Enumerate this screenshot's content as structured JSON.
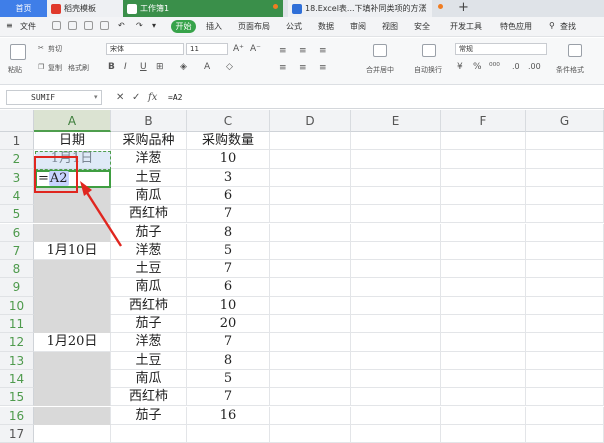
{
  "tabs": {
    "home": "首页",
    "template": "稻壳模板",
    "workbook": "工作簿1",
    "document": "18.Excel表...下填补同类项的方法"
  },
  "menu": {
    "file": "文件",
    "start": "开始",
    "items": [
      "插入",
      "页面布局",
      "公式",
      "数据",
      "审阅",
      "视图",
      "安全",
      "开发工具",
      "特色应用"
    ],
    "search": "查找"
  },
  "ribbon": {
    "cut": "剪切",
    "copy": "复制",
    "paste": "粘贴",
    "format_painter": "格式刷",
    "font": "宋体",
    "font_size": "11",
    "merge": "合并居中",
    "wrap": "自动换行",
    "number_format": "常规",
    "cond_format": "条件格式"
  },
  "formula_bar": {
    "name_box": "SUMIF",
    "cancel": "✕",
    "confirm": "✓",
    "fx": "fx",
    "formula": "=A2"
  },
  "grid": {
    "columns": [
      "A",
      "B",
      "C",
      "D",
      "E",
      "F",
      "G"
    ],
    "rows": [
      "1",
      "2",
      "3",
      "4",
      "5",
      "6",
      "7",
      "8",
      "9",
      "10",
      "11",
      "12",
      "13",
      "14",
      "15",
      "16",
      "17"
    ],
    "colA": [
      "日期",
      "1月1日",
      "",
      "",
      "",
      "",
      "1月10日",
      "",
      "",
      "",
      "",
      "1月20日",
      "",
      "",
      "",
      "",
      ""
    ],
    "colB": [
      "采购品种",
      "洋葱",
      "土豆",
      "南瓜",
      "西红柿",
      "茄子",
      "洋葱",
      "土豆",
      "南瓜",
      "西红柿",
      "茄子",
      "洋葱",
      "土豆",
      "南瓜",
      "西红柿",
      "茄子",
      ""
    ],
    "colC": [
      "采购数量",
      "10",
      "3",
      "6",
      "7",
      "8",
      "5",
      "7",
      "6",
      "10",
      "20",
      "7",
      "8",
      "5",
      "7",
      "16",
      ""
    ],
    "active_formula_eq": "=",
    "active_formula_ref": "A2"
  }
}
